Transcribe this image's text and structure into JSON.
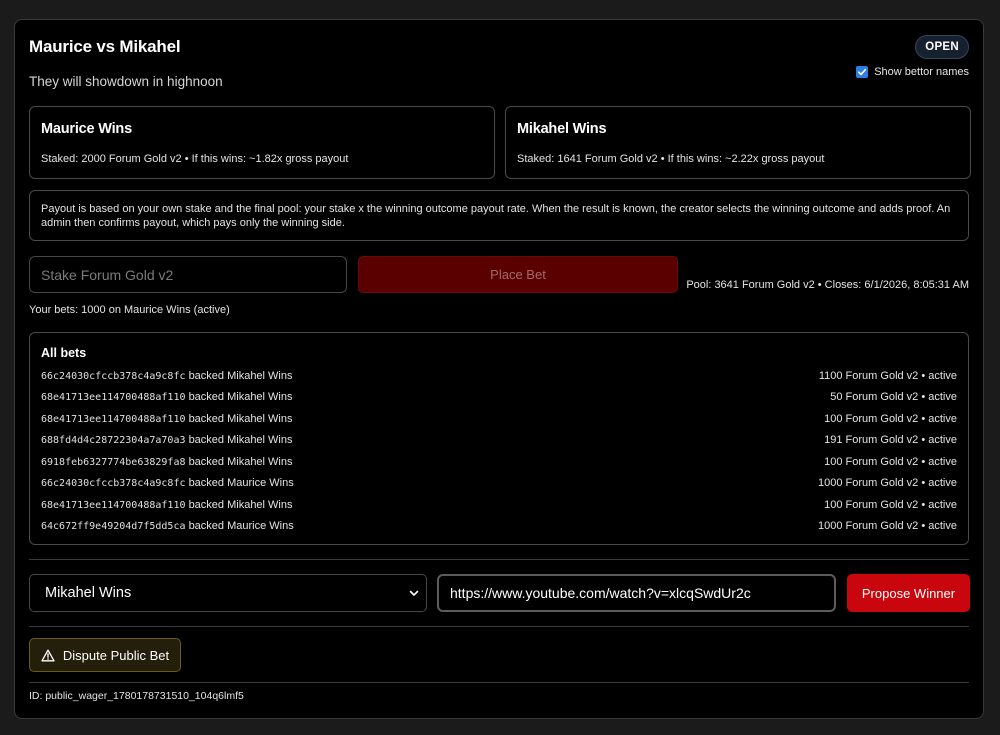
{
  "wager": {
    "title": "Maurice vs Mikahel",
    "description": "They will showdown in highnoon",
    "status": "OPEN",
    "show_bettor_names_label": "Show bettor names",
    "show_bettor_names_checked": true
  },
  "outcomes": [
    {
      "name": "Maurice Wins",
      "stats": "Staked: 2000 Forum Gold v2 • If this wins: ~1.82x gross payout"
    },
    {
      "name": "Mikahel Wins",
      "stats": "Staked: 1641 Forum Gold v2 • If this wins: ~2.22x gross payout"
    }
  ],
  "info_text": "Payout is based on your own stake and the final pool: your stake x the winning outcome payout rate. When the result is known, the creator selects the winning outcome and adds proof. An admin then confirms payout, which pays only the winning side.",
  "bet_form": {
    "stake_placeholder": "Stake Forum Gold v2",
    "place_bet_label": "Place Bet",
    "pool_info": "Pool: 3641 Forum Gold v2 • Closes: 6/1/2026, 8:05:31 AM",
    "your_bets": "Your bets: 1000 on Maurice Wins (active)"
  },
  "all_bets": {
    "title": "All bets",
    "rows": [
      {
        "id": "66c24030cfccb378c4a9c8fc",
        "action": "backed Mikahel Wins",
        "amount": "1100 Forum Gold v2 • active"
      },
      {
        "id": "68e41713ee114700488af110",
        "action": "backed Mikahel Wins",
        "amount": "50 Forum Gold v2 • active"
      },
      {
        "id": "68e41713ee114700488af110",
        "action": "backed Mikahel Wins",
        "amount": "100 Forum Gold v2 • active"
      },
      {
        "id": "688fd4d4c28722304a7a70a3",
        "action": "backed Mikahel Wins",
        "amount": "191 Forum Gold v2 • active"
      },
      {
        "id": "6918feb6327774be63829fa8",
        "action": "backed Mikahel Wins",
        "amount": "100 Forum Gold v2 • active"
      },
      {
        "id": "66c24030cfccb378c4a9c8fc",
        "action": "backed Maurice Wins",
        "amount": "1000 Forum Gold v2 • active"
      },
      {
        "id": "68e41713ee114700488af110",
        "action": "backed Mikahel Wins",
        "amount": "100 Forum Gold v2 • active"
      },
      {
        "id": "64c672ff9e49204d7f5dd5ca",
        "action": "backed Maurice Wins",
        "amount": "1000 Forum Gold v2 • active"
      }
    ]
  },
  "resolve": {
    "selected_outcome": "Mikahel Wins",
    "proof_url": "https://www.youtube.com/watch?v=xlcqSwdUr2c",
    "propose_label": "Propose Winner",
    "dispute_label": "Dispute Public Bet"
  },
  "id_line": "ID: public_wager_1780178731510_104q6lmf5",
  "colors": {
    "accent_red": "#c9060d",
    "disabled_red": "#5a0000",
    "checkbox_blue": "#2f7ee6",
    "warning_border": "#6a5a1d"
  },
  "icons": {
    "toggle": "check-icon",
    "select": "chevron-down-icon",
    "dispute": "warning-triangle-icon"
  }
}
